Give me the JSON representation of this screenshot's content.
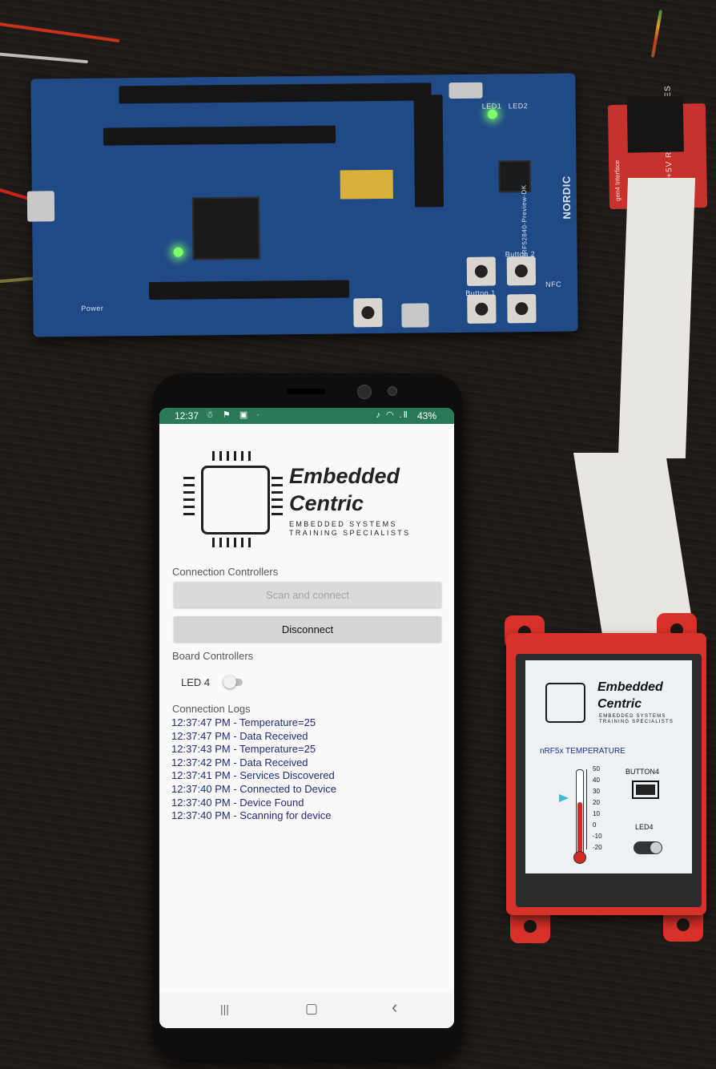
{
  "phone": {
    "status_bar": {
      "time": "12:37",
      "left_icons": "☃ ⚑ ▣ ·",
      "right_icons": "♪ ◠ .Ⅱ",
      "battery": "43%"
    },
    "logo": {
      "line1": "Embedded",
      "line2": "Centric",
      "tagline1": "EMBEDDED SYSTEMS",
      "tagline2": "TRAINING SPECIALISTS"
    },
    "connection_controllers": {
      "title": "Connection Controllers",
      "scan_label": "Scan and connect",
      "disconnect_label": "Disconnect"
    },
    "board_controllers": {
      "title": "Board Controllers",
      "led_label": "LED 4",
      "led_state": "off"
    },
    "logs": {
      "title": "Connection Logs",
      "entries": [
        "12:37:47 PM - Temperature=25",
        "12:37:47 PM - Data Received",
        "12:37:43 PM - Temperature=25",
        "12:37:42 PM - Data Received",
        "12:37:41 PM - Services Discovered",
        "12:37:40 PM - Connected to Device",
        "12:37:40 PM - Device Found",
        "12:37:40 PM - Scanning for device"
      ]
    },
    "nav": {
      "recents": "|||",
      "home": "▢",
      "back": "‹"
    },
    "accent_color": "#2a7a55"
  },
  "tft": {
    "logo": {
      "line1": "Embedded",
      "line2": "Centric",
      "tagline1": "EMBEDDED SYSTEMS",
      "tagline2": "TRAINING SPECIALISTS"
    },
    "title": "nRF5x TEMPERATURE",
    "scale_labels": [
      "50",
      "40",
      "30",
      "20",
      "10",
      "0",
      "-10",
      "-20"
    ],
    "temperature": 25,
    "button_label": "BUTTON4",
    "led_label": "LED4"
  },
  "board": {
    "silkscreen": [
      "nRF52840-Preview-DK",
      "NORDIC",
      "LED1",
      "LED2",
      "Button 1",
      "Button 2",
      "NFC",
      "Power"
    ]
  },
  "adapter": {
    "pins": "+5V RX TX GND RES",
    "label": "gen4 Interface"
  }
}
